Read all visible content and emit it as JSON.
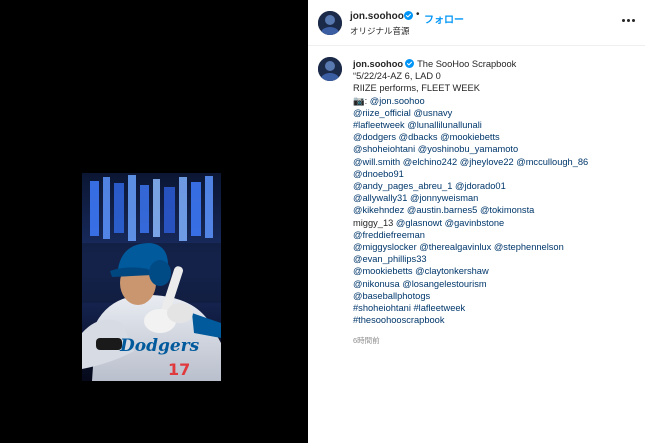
{
  "post": {
    "username": "jon.soohoo",
    "follow_label": "フォロー",
    "audio_label": "オリジナル音源",
    "dot_separator": "•"
  },
  "caption": {
    "username": "jon.soohoo",
    "title": "The SooHoo Scrapbook",
    "lines": [
      [
        {
          "t": "“5/22/24-AZ 6, LAD 0",
          "m": false
        }
      ],
      [
        {
          "t": "RIIZE performs, FLEET WEEK",
          "m": false
        }
      ],
      [
        {
          "t": "📷: ",
          "m": false
        },
        {
          "t": "@jon.soohoo",
          "m": true
        }
      ],
      [
        {
          "t": "@riize_official",
          "m": true
        },
        {
          "t": " ",
          "m": false
        },
        {
          "t": "@usnavy",
          "m": true
        }
      ],
      [
        {
          "t": "#lafleetweek",
          "m": true
        },
        {
          "t": " ",
          "m": false
        },
        {
          "t": "@lunallilunallunali",
          "m": true
        }
      ],
      [
        {
          "t": "@dodgers",
          "m": true
        },
        {
          "t": " ",
          "m": false
        },
        {
          "t": "@dbacks",
          "m": true
        },
        {
          "t": " ",
          "m": false
        },
        {
          "t": "@mookiebetts",
          "m": true
        }
      ],
      [
        {
          "t": "@shoheiohtani",
          "m": true
        },
        {
          "t": " ",
          "m": false
        },
        {
          "t": "@yoshinobu_yamamoto",
          "m": true
        }
      ],
      [
        {
          "t": "@will.smith",
          "m": true
        },
        {
          "t": " ",
          "m": false
        },
        {
          "t": "@elchino242",
          "m": true
        },
        {
          "t": " ",
          "m": false
        },
        {
          "t": "@jheylove22",
          "m": true
        },
        {
          "t": " ",
          "m": false
        },
        {
          "t": "@mccullough_86",
          "m": true
        }
      ],
      [
        {
          "t": "@dnoebo91",
          "m": true
        }
      ],
      [
        {
          "t": "@andy_pages_abreu_1",
          "m": true
        },
        {
          "t": " ",
          "m": false
        },
        {
          "t": "@jdorado01",
          "m": true
        }
      ],
      [
        {
          "t": "@allywally31",
          "m": true
        },
        {
          "t": " ",
          "m": false
        },
        {
          "t": "@jonnyweisman",
          "m": true
        }
      ],
      [
        {
          "t": "@kikehndez",
          "m": true
        },
        {
          "t": " ",
          "m": false
        },
        {
          "t": "@austin.barnes5",
          "m": true
        },
        {
          "t": " ",
          "m": false
        },
        {
          "t": "@tokimonsta",
          "m": true
        }
      ],
      [
        {
          "t": "miggy_13 ",
          "m": false
        },
        {
          "t": "@glasnowt",
          "m": true
        },
        {
          "t": " ",
          "m": false
        },
        {
          "t": "@gavinbstone",
          "m": true
        }
      ],
      [
        {
          "t": "@freddiefreeman",
          "m": true
        }
      ],
      [
        {
          "t": "@miggyslocker",
          "m": true
        },
        {
          "t": " ",
          "m": false
        },
        {
          "t": "@therealgavinlux",
          "m": true
        },
        {
          "t": " ",
          "m": false
        },
        {
          "t": "@stephennelson",
          "m": true
        }
      ],
      [
        {
          "t": "@evan_phillips33",
          "m": true
        }
      ],
      [
        {
          "t": "@mookiebetts",
          "m": true
        },
        {
          "t": " ",
          "m": false
        },
        {
          "t": "@claytonkershaw",
          "m": true
        }
      ],
      [
        {
          "t": "@nikonusa",
          "m": true
        },
        {
          "t": " ",
          "m": false
        },
        {
          "t": "@losangelestourism",
          "m": true
        }
      ],
      [
        {
          "t": "@baseballphotogs",
          "m": true
        }
      ],
      [
        {
          "t": "#shoheiohtani",
          "m": true
        },
        {
          "t": " ",
          "m": false
        },
        {
          "t": "#lafleetweek",
          "m": true
        }
      ],
      [
        {
          "t": "#thesoohooscrapbook",
          "m": true
        }
      ]
    ],
    "timestamp": "6時間前"
  },
  "photo": {
    "jersey_text": "Dodgers",
    "jersey_number": "17"
  },
  "colors": {
    "link": "#00376b",
    "follow": "#0095f6",
    "verified": "#0095f6",
    "dodger_blue": "#005a9c",
    "jersey_red": "#e03a3e"
  }
}
